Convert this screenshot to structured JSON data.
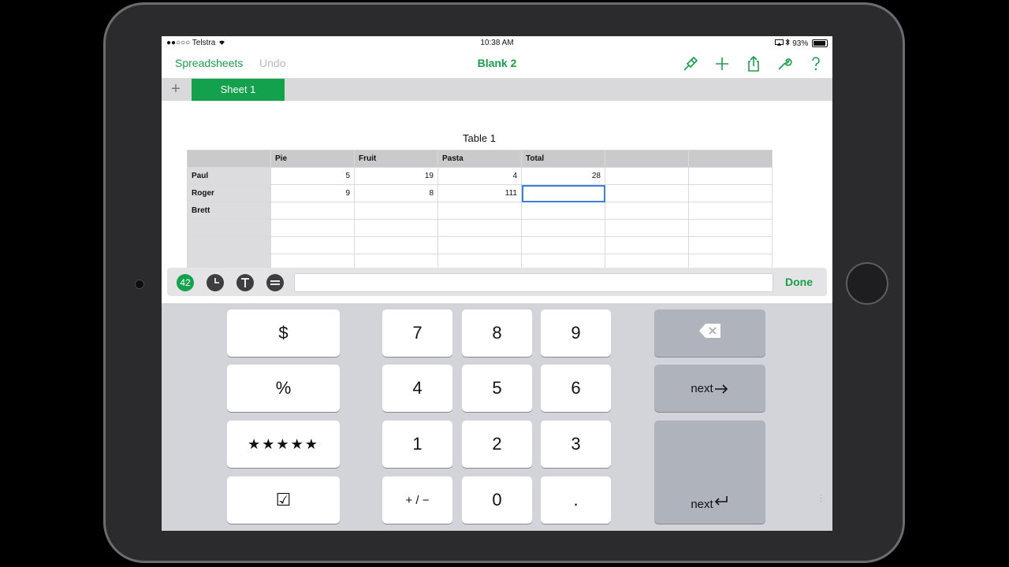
{
  "status": {
    "carrier": "●●○○○ Telstra",
    "time": "10:38 AM",
    "battery": "93%",
    "battery_level": 0.93
  },
  "nav": {
    "back_label": "Spreadsheets",
    "undo_label": "Undo",
    "title": "Blank 2"
  },
  "sheets": {
    "add_symbol": "+",
    "active_tab": "Sheet 1"
  },
  "table": {
    "title": "Table 1",
    "columns": [
      "",
      "Pie",
      "Fruit",
      "Pasta",
      "Total",
      "",
      ""
    ],
    "rows": [
      {
        "name": "Paul",
        "cells": [
          "5",
          "19",
          "4",
          "28",
          "",
          ""
        ]
      },
      {
        "name": "Roger",
        "cells": [
          "9",
          "8",
          "111",
          "",
          "",
          ""
        ]
      },
      {
        "name": "Brett",
        "cells": [
          "",
          "",
          "",
          "",
          "",
          ""
        ]
      },
      {
        "name": "",
        "cells": [
          "",
          "",
          "",
          "",
          "",
          ""
        ]
      },
      {
        "name": "",
        "cells": [
          "",
          "",
          "",
          "",
          "",
          ""
        ]
      },
      {
        "name": "",
        "cells": [
          "",
          "",
          "",
          "",
          "",
          ""
        ]
      }
    ]
  },
  "formula_bar": {
    "number_format_label": "42",
    "done_label": "Done",
    "value": ""
  },
  "keyboard": {
    "currency": "$",
    "percent": "%",
    "rating": "★★★★★",
    "checkbox": "☑",
    "seven": "7",
    "eight": "8",
    "nine": "9",
    "four": "4",
    "five": "5",
    "six": "6",
    "one": "1",
    "two": "2",
    "three": "3",
    "plus_minus": "+ / −",
    "zero": "0",
    "decimal": ".",
    "next_right": "next",
    "next_return": "next"
  }
}
